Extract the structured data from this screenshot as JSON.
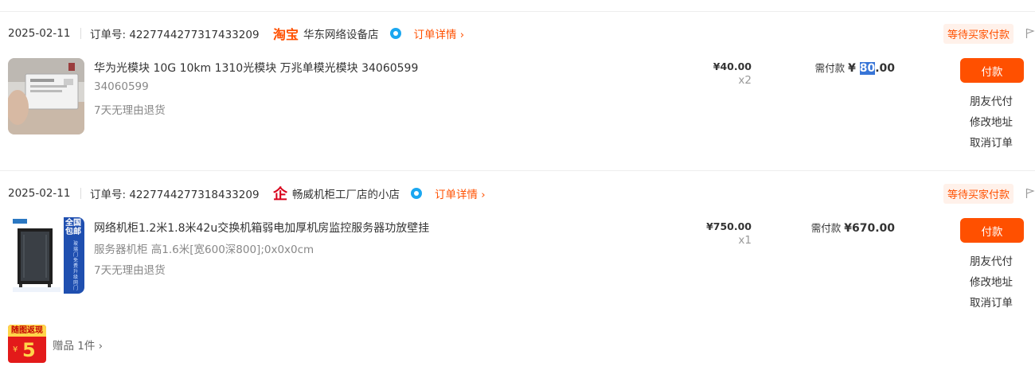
{
  "orders": [
    {
      "date": "2025-02-11",
      "order_no": "订单号: 4227744277317433209",
      "platform_logo": "淘宝",
      "store_name": "华东网络设备店",
      "detail_link": "订单详情 ›",
      "status": "等待买家付款",
      "item": {
        "title": "华为光模块 10G 10km 1310光模块 万兆单模光模块 34060599",
        "spec": "34060599",
        "guarantee": "7天无理由退货",
        "unit_price": "¥40.00",
        "qty": "x2",
        "need_pay_label": "需付款",
        "amount_currency": "¥",
        "amount_highlight": "80",
        "amount_rest": ".00"
      },
      "actions": {
        "pay": "付款",
        "friend_pay": "朋友代付",
        "edit_address": "修改地址",
        "cancel": "取消订单"
      }
    },
    {
      "date": "2025-02-11",
      "order_no": "订单号: 4227744277318433209",
      "platform_logo": "企",
      "store_name": "畅威机柜工厂店的小店",
      "detail_link": "订单详情 ›",
      "status": "等待买家付款",
      "item": {
        "title": "网络机柜1.2米1.8米42u交换机箱弱电加厚机房监控服务器功放壁挂",
        "spec": "服务器机柜 高1.6米[宽600深800];0x0x0cm",
        "guarantee": "7天无理由退货",
        "unit_price": "¥750.00",
        "qty": "x1",
        "need_pay_label": "需付款",
        "amount": "¥670.00",
        "thumb_badge_top": "全国包邮",
        "thumb_badge_bottom": "玻璃门免费升级网门"
      },
      "actions": {
        "pay": "付款",
        "friend_pay": "朋友代付",
        "edit_address": "修改地址",
        "cancel": "取消订单"
      }
    }
  ],
  "gift": {
    "badge_top": "随图返现",
    "badge_value": "5",
    "badge_currency": "¥",
    "label": "赠品 1件 ›"
  },
  "colors": {
    "accent": "#ff5000",
    "badge_bg": "#fff1ea",
    "text": "#333333",
    "muted": "#888888"
  }
}
